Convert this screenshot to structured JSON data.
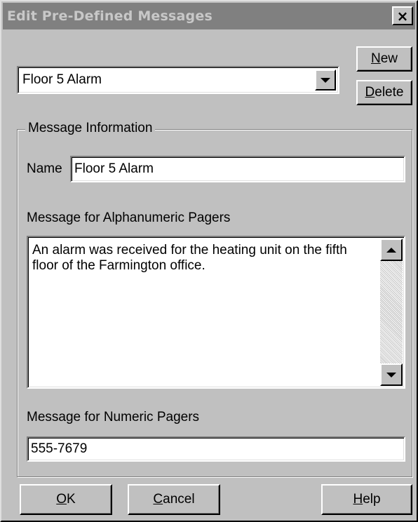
{
  "window": {
    "title": "Edit Pre-Defined Messages",
    "close_glyph": "×"
  },
  "top": {
    "selected_message": "Floor 5 Alarm",
    "new_button": {
      "prefix": "",
      "mnemonic": "N",
      "suffix": "ew"
    },
    "delete_button": {
      "prefix": "",
      "mnemonic": "D",
      "suffix": "elete"
    }
  },
  "group": {
    "title": "Message Information",
    "name_label": "Name",
    "name_value": "Floor 5 Alarm",
    "alpha_label": "Message for Alphanumeric Pagers",
    "alpha_value": "An alarm was received for the heating unit on the fifth floor of the Farmington office.",
    "numeric_label": "Message for Numeric Pagers",
    "numeric_value": "555-7679"
  },
  "buttons": {
    "ok": {
      "prefix": "",
      "mnemonic": "O",
      "suffix": "K"
    },
    "cancel": {
      "prefix": "",
      "mnemonic": "C",
      "suffix": "ancel"
    },
    "help": {
      "prefix": "",
      "mnemonic": "H",
      "suffix": "elp"
    }
  },
  "icons": {
    "combo_arrow": "triangle-down",
    "scroll_up": "triangle-up",
    "scroll_down": "triangle-down"
  },
  "colors": {
    "dialog_bg": "#c0c0c0",
    "inactive_title_bg": "#808080",
    "field_bg": "#ffffff"
  }
}
